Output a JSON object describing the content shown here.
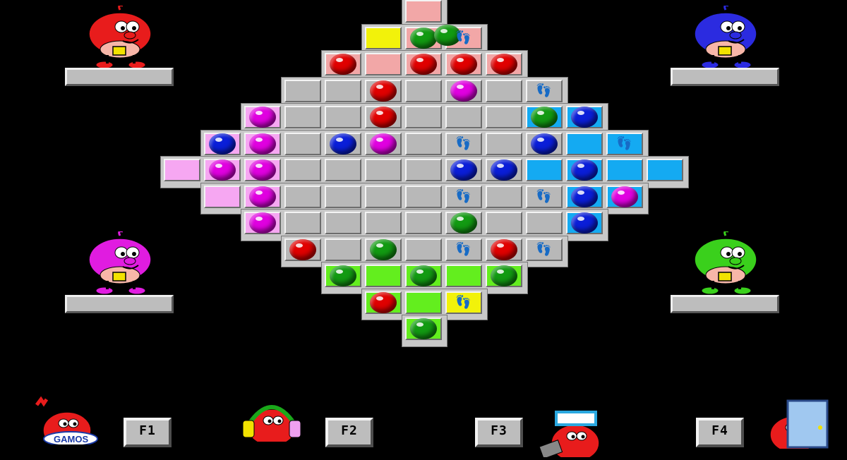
{
  "game": {
    "board": {
      "cell_colors": {
        "gray": "#b8b8b8",
        "red_home": "#f2a7a7",
        "magenta_home": "#f6a7f2",
        "blue_home": "#14aaf2",
        "green_home": "#63ee1e",
        "yellow": "#f2f20a",
        "frame": "#c8c8c8"
      },
      "ball_colors": {
        "red": "#e00000",
        "magenta": "#e000e0",
        "blue": "#0a1ed8",
        "green": "#129a12"
      },
      "footprint_glyph": "👣"
    },
    "players": [
      {
        "color": "red",
        "hex": "#e81c1c",
        "score": ""
      },
      {
        "color": "blue",
        "hex": "#2b2be0",
        "score": ""
      },
      {
        "color": "magenta",
        "hex": "#e01ce0",
        "score": ""
      },
      {
        "color": "green",
        "hex": "#3ad01c",
        "score": ""
      }
    ],
    "function_keys": [
      {
        "label": "F1",
        "icon": "gamos-logo-icon"
      },
      {
        "label": "F2",
        "icon": "headphones-music-icon"
      },
      {
        "label": "F3",
        "icon": "glasses-keyboard-icon"
      },
      {
        "label": "F4",
        "icon": "exit-door-icon"
      }
    ],
    "gamos_logo_text": "GAMOS"
  }
}
